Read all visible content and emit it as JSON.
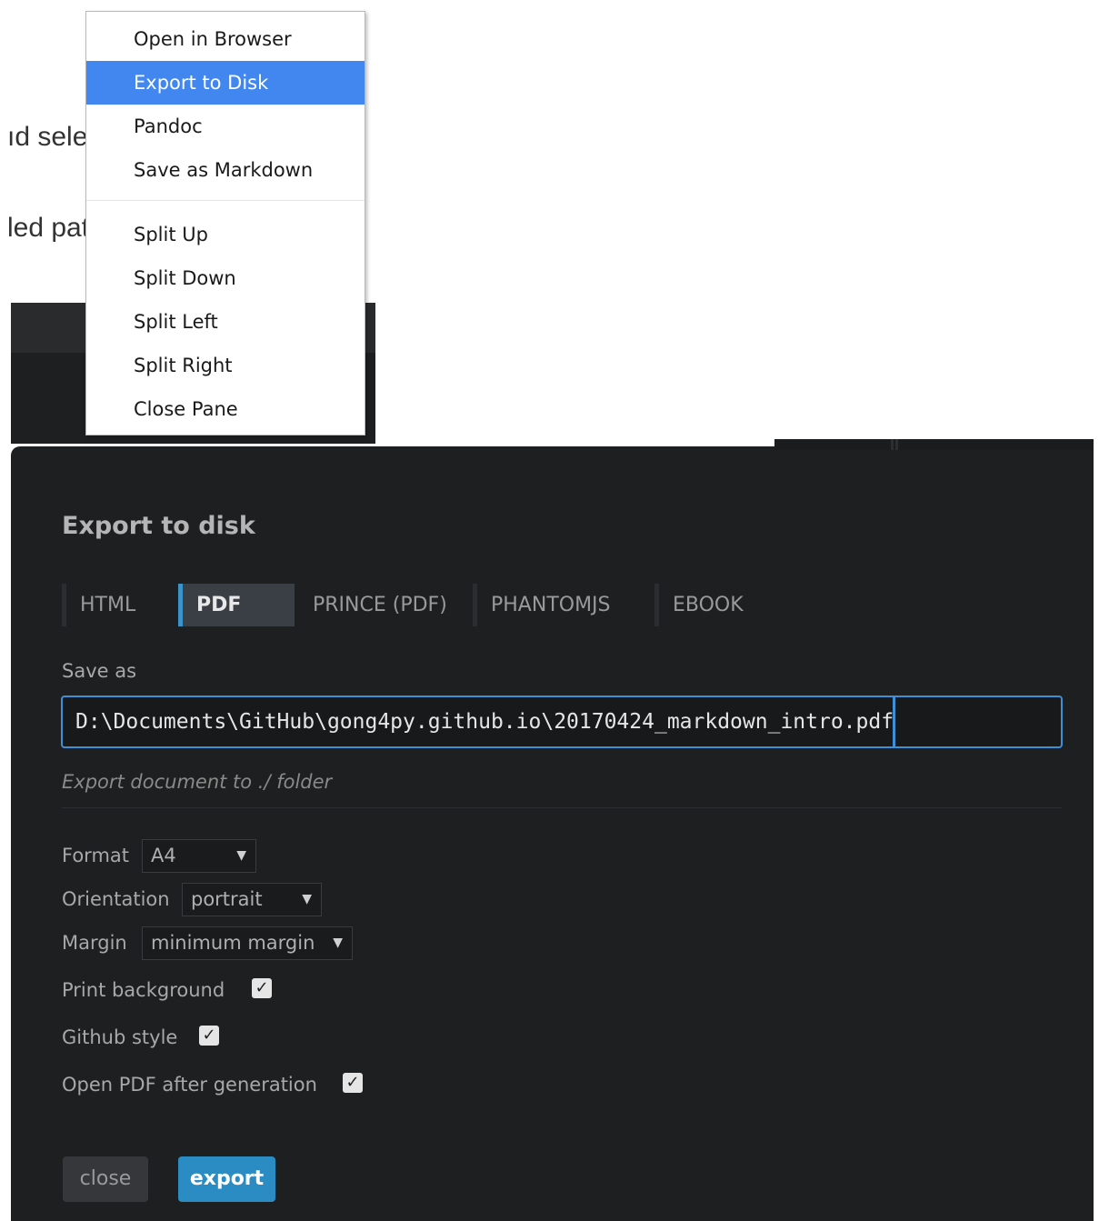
{
  "background": {
    "line1": "ıd select",
    "line2": "led path"
  },
  "context_menu": {
    "items": [
      {
        "label": "Open in Browser"
      },
      {
        "label": "Export to Disk"
      },
      {
        "label": "Pandoc"
      },
      {
        "label": "Save as Markdown"
      },
      {
        "label": "Split Up"
      },
      {
        "label": "Split Down"
      },
      {
        "label": "Split Left"
      },
      {
        "label": "Split Right"
      },
      {
        "label": "Close Pane"
      }
    ]
  },
  "dialog": {
    "title": "Export to disk",
    "tabs": [
      {
        "label": "HTML"
      },
      {
        "label": "PDF"
      },
      {
        "label": "PRINCE (PDF)"
      },
      {
        "label": "PHANTOMJS"
      },
      {
        "label": "EBOOK"
      }
    ],
    "active_tab": "PDF",
    "save_as_label": "Save as",
    "save_as_value": "D:\\Documents\\GitHub\\gong4py.github.io\\20170424_markdown_intro.pdf",
    "hint": "Export document to ./ folder",
    "format_label": "Format",
    "format_value": "A4",
    "orientation_label": "Orientation",
    "orientation_value": "portrait",
    "margin_label": "Margin",
    "margin_value": "minimum margin",
    "print_background_label": "Print background",
    "print_background_checked": true,
    "github_style_label": "Github style",
    "github_style_checked": true,
    "open_pdf_label": "Open PDF after generation",
    "open_pdf_checked": true,
    "close_label": "close",
    "export_label": "export",
    "dropdown_arrow": "▼",
    "check_mark": "✓"
  },
  "colors": {
    "menu_highlight": "#4287f0",
    "dialog_background": "#1e1f21",
    "accent": "#3d8fd8",
    "export_button": "#2b8cc4"
  }
}
